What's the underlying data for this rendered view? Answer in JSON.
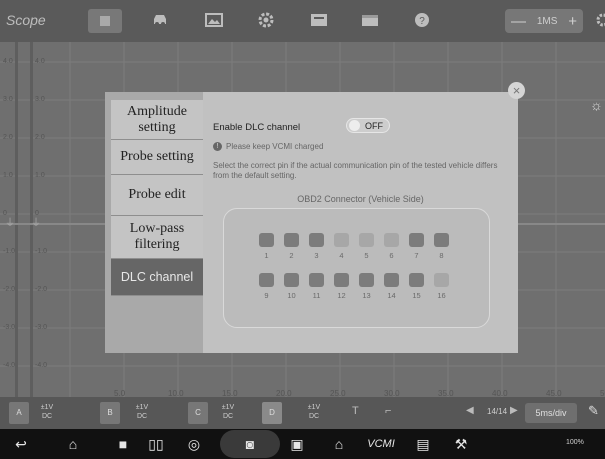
{
  "app": {
    "title": "Scope"
  },
  "toolbar": {
    "icons": [
      "stop-icon",
      "car-icon",
      "image-icon",
      "gear-icon",
      "screen-icon",
      "folder-icon",
      "help-icon",
      "settings-icon"
    ],
    "timebase_value": "1MS",
    "minus": "—",
    "plus": "+"
  },
  "plot": {
    "x_ticks": [
      "5.0",
      "10.0",
      "15.0",
      "20.0",
      "25.0",
      "30.0",
      "35.0",
      "40.0",
      "45.0",
      "50.0ms"
    ],
    "y_ticks_left": [
      "4.0",
      "3.0",
      "2.0",
      "1.0",
      "0",
      "-1.0",
      "-2.0",
      "-3.0",
      "-4.0"
    ]
  },
  "channels": [
    {
      "name": "A",
      "volts": "±1V",
      "coupling": "DC"
    },
    {
      "name": "B",
      "volts": "±1V",
      "coupling": "DC"
    },
    {
      "name": "C",
      "volts": "±1V",
      "coupling": "DC"
    },
    {
      "name": "D",
      "volts": "±1V",
      "coupling": "DC"
    }
  ],
  "bottom": {
    "page": "14/14",
    "timebase": "5ms/div"
  },
  "status": {
    "battery": "100%"
  },
  "modal": {
    "menu": [
      {
        "label": "Amplitude setting",
        "active": false
      },
      {
        "label": "Probe setting",
        "active": false
      },
      {
        "label": "Probe edit",
        "active": false
      },
      {
        "label": "Low-pass filtering",
        "active": false
      },
      {
        "label": "DLC channel",
        "active": true
      }
    ],
    "enable_label": "Enable DLC channel",
    "toggle_state": "OFF",
    "note": "Please keep VCMI charged",
    "description": "Select the correct pin if the actual communication pin of the tested vehicle differs from the default setting.",
    "connector_title": "OBD2 Connector (Vehicle Side)",
    "pins_top": [
      "1",
      "2",
      "3",
      "4",
      "5",
      "6",
      "7",
      "8"
    ],
    "pins_bottom": [
      "9",
      "10",
      "11",
      "12",
      "13",
      "14",
      "15",
      "16"
    ],
    "highlighted_pins": [
      "4",
      "5",
      "6",
      "16"
    ]
  },
  "colors": {
    "panel_bg": "#c1c1c1",
    "active_menu": "#666666",
    "toolbar": "#5a5a5a",
    "plot_bg": "#6f6f6f"
  }
}
